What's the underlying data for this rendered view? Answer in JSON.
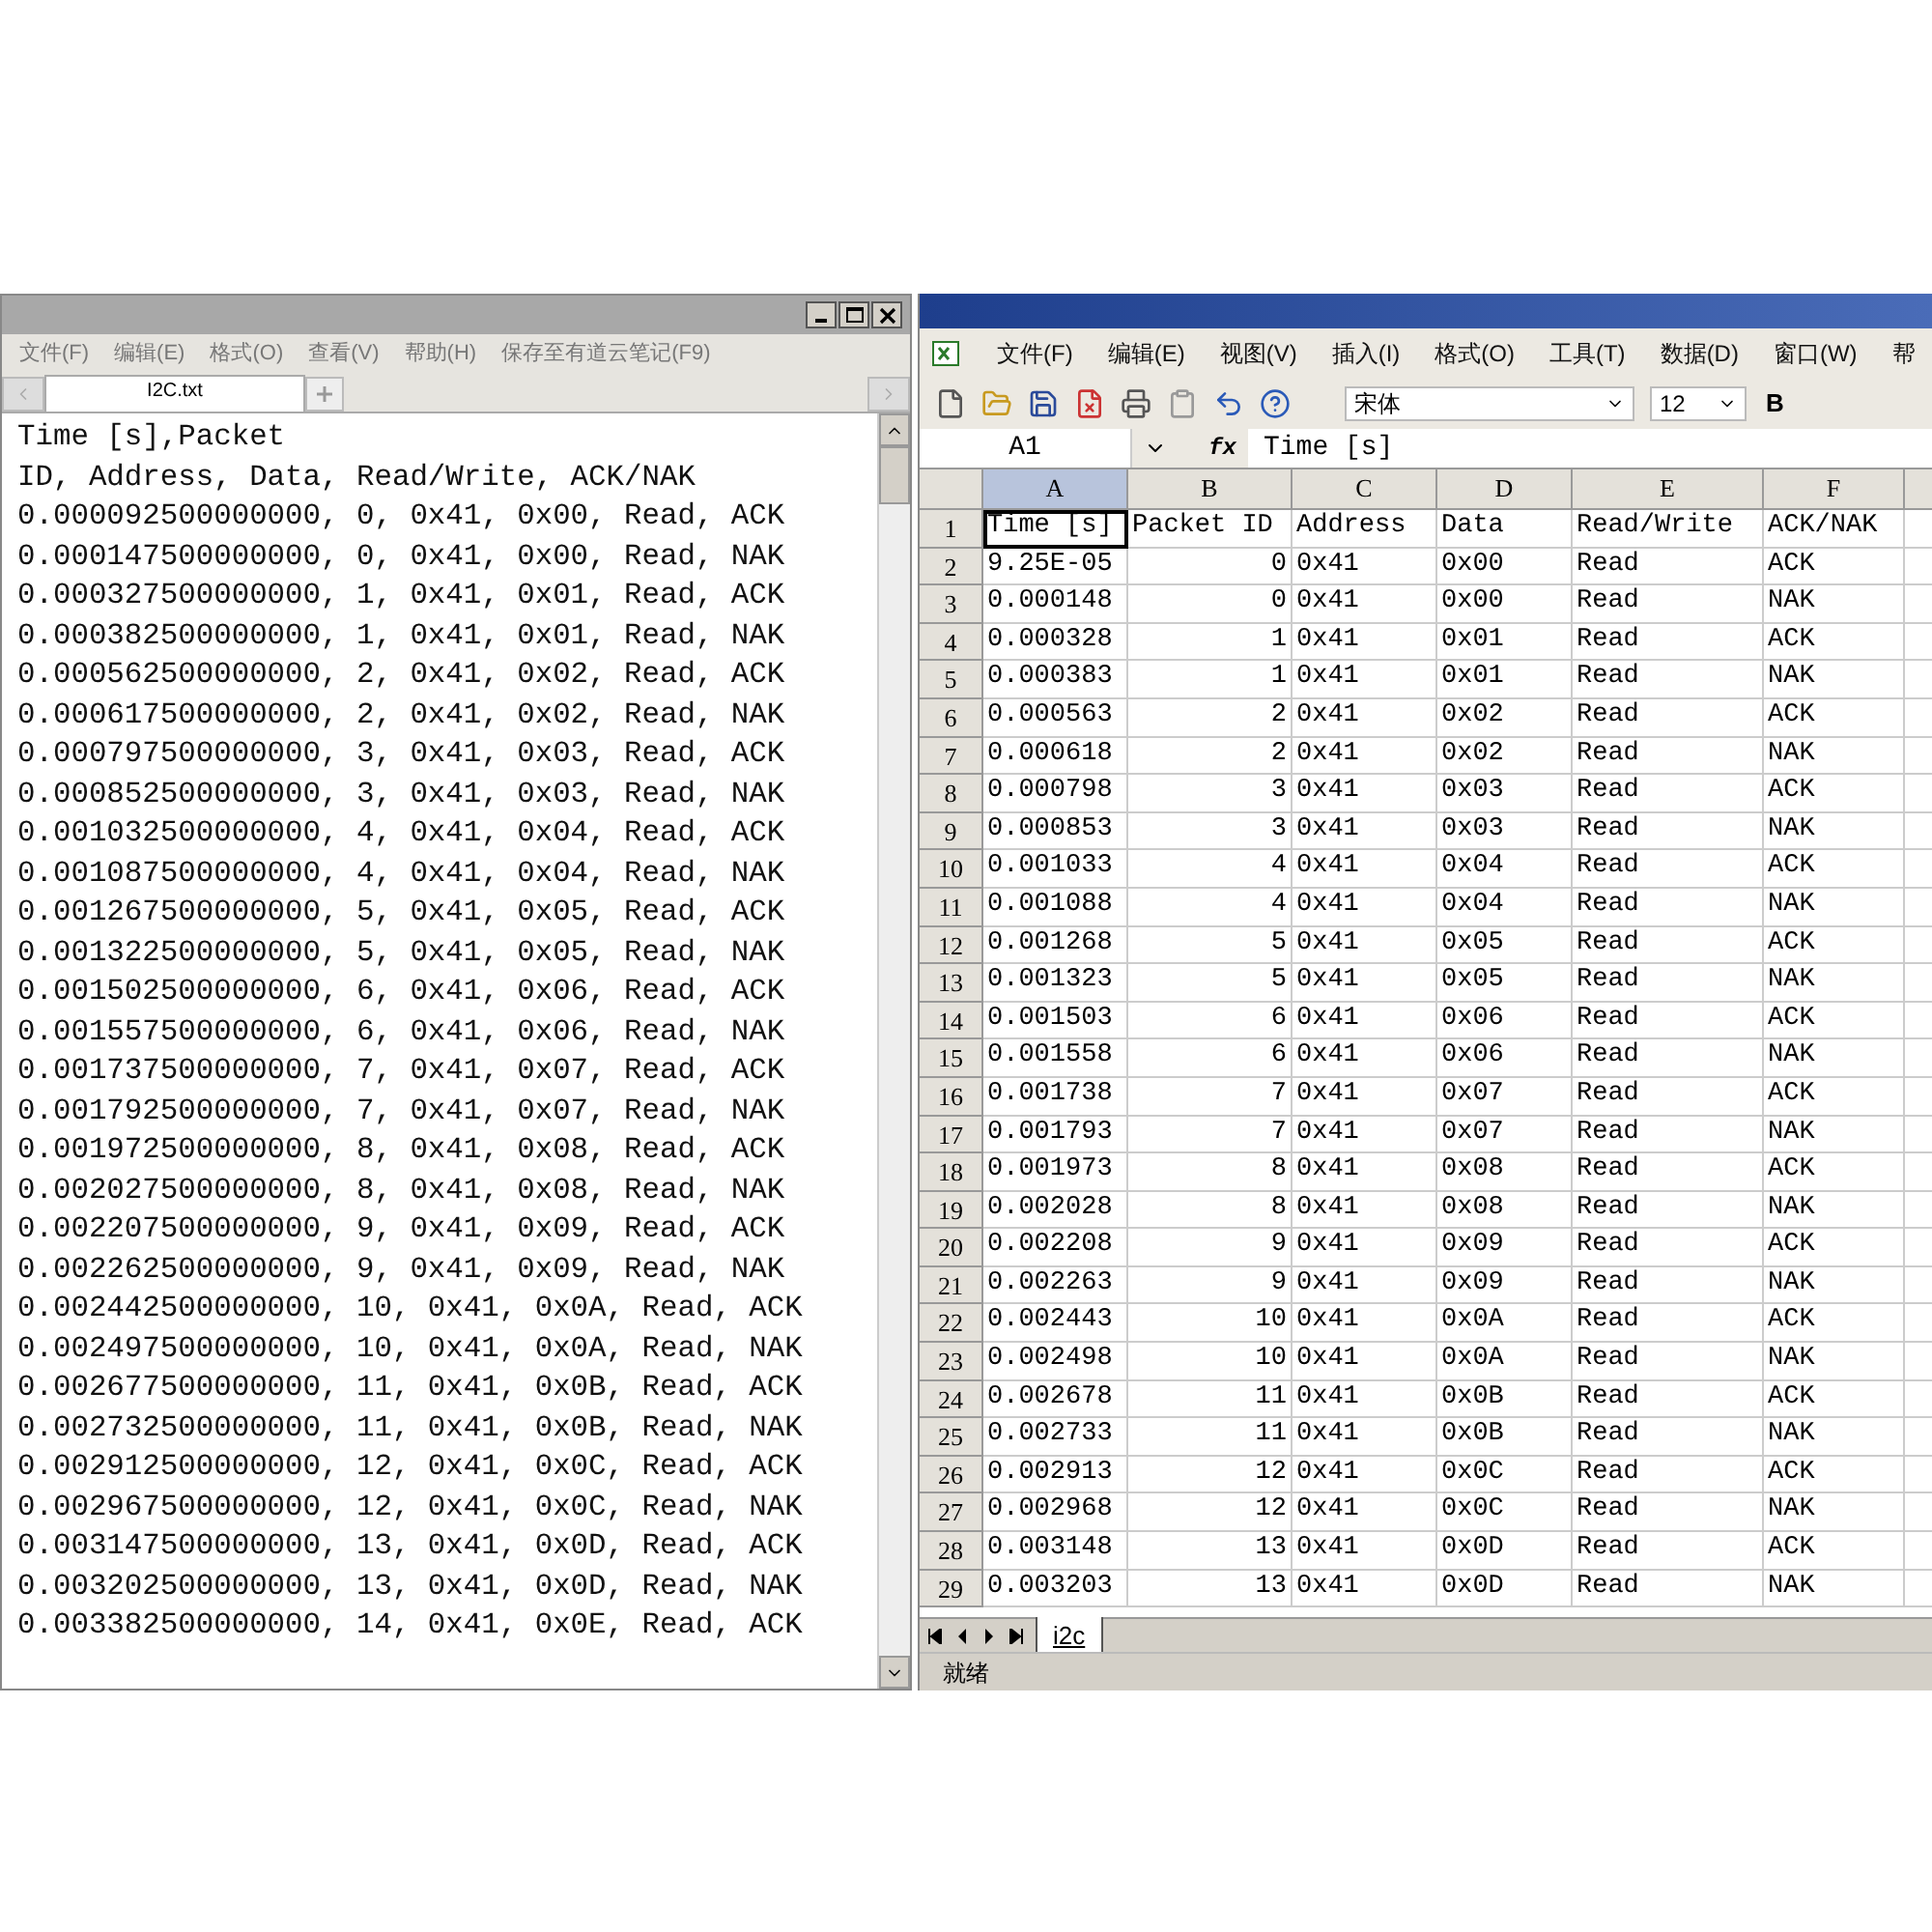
{
  "notepad": {
    "menu": [
      "文件(F)",
      "编辑(E)",
      "格式(O)",
      "查看(V)",
      "帮助(H)",
      "保存至有道云笔记(F9)"
    ],
    "tabs": [
      {
        "label": "I2C.txt",
        "selected": true
      }
    ],
    "lines": [
      "Time [s],Packet",
      "ID, Address, Data, Read/Write, ACK/NAK",
      "0.000092500000000, 0, 0x41, 0x00, Read, ACK",
      "0.000147500000000, 0, 0x41, 0x00, Read, NAK",
      "0.000327500000000, 1, 0x41, 0x01, Read, ACK",
      "0.000382500000000, 1, 0x41, 0x01, Read, NAK",
      "0.000562500000000, 2, 0x41, 0x02, Read, ACK",
      "0.000617500000000, 2, 0x41, 0x02, Read, NAK",
      "0.000797500000000, 3, 0x41, 0x03, Read, ACK",
      "0.000852500000000, 3, 0x41, 0x03, Read, NAK",
      "0.001032500000000, 4, 0x41, 0x04, Read, ACK",
      "0.001087500000000, 4, 0x41, 0x04, Read, NAK",
      "0.001267500000000, 5, 0x41, 0x05, Read, ACK",
      "0.001322500000000, 5, 0x41, 0x05, Read, NAK",
      "0.001502500000000, 6, 0x41, 0x06, Read, ACK",
      "0.001557500000000, 6, 0x41, 0x06, Read, NAK",
      "0.001737500000000, 7, 0x41, 0x07, Read, ACK",
      "0.001792500000000, 7, 0x41, 0x07, Read, NAK",
      "0.001972500000000, 8, 0x41, 0x08, Read, ACK",
      "0.002027500000000, 8, 0x41, 0x08, Read, NAK",
      "0.002207500000000, 9, 0x41, 0x09, Read, ACK",
      "0.002262500000000, 9, 0x41, 0x09, Read, NAK",
      "0.002442500000000, 10, 0x41, 0x0A, Read, ACK",
      "0.002497500000000, 10, 0x41, 0x0A, Read, NAK",
      "0.002677500000000, 11, 0x41, 0x0B, Read, ACK",
      "0.002732500000000, 11, 0x41, 0x0B, Read, NAK",
      "0.002912500000000, 12, 0x41, 0x0C, Read, ACK",
      "0.002967500000000, 12, 0x41, 0x0C, Read, NAK",
      "0.003147500000000, 13, 0x41, 0x0D, Read, ACK",
      "0.003202500000000, 13, 0x41, 0x0D, Read, NAK",
      "0.003382500000000, 14, 0x41, 0x0E, Read, ACK"
    ]
  },
  "spreadsheet": {
    "menu": [
      "文件(F)",
      "编辑(E)",
      "视图(V)",
      "插入(I)",
      "格式(O)",
      "工具(T)",
      "数据(D)",
      "窗口(W)",
      "帮"
    ],
    "font": "宋体",
    "font_size": "12",
    "bold_button": "B",
    "name_box": "A1",
    "fx": "fx",
    "formula": "Time [s]",
    "columns": [
      {
        "label": "A",
        "selected": true
      },
      {
        "label": "B",
        "selected": false
      },
      {
        "label": "C",
        "selected": false
      },
      {
        "label": "D",
        "selected": false
      },
      {
        "label": "E",
        "selected": false
      },
      {
        "label": "F",
        "selected": false
      }
    ],
    "rows": [
      {
        "number": "1",
        "cells": [
          "Time [s]",
          "Packet ID",
          "Address",
          "Data",
          "Read/Write",
          "ACK/NAK"
        ]
      },
      {
        "number": "2",
        "cells": [
          "9.25E-05",
          "0",
          "0x41",
          "0x00",
          "Read",
          "ACK"
        ]
      },
      {
        "number": "3",
        "cells": [
          "0.000148",
          "0",
          "0x41",
          "0x00",
          "Read",
          "NAK"
        ]
      },
      {
        "number": "4",
        "cells": [
          "0.000328",
          "1",
          "0x41",
          "0x01",
          "Read",
          "ACK"
        ]
      },
      {
        "number": "5",
        "cells": [
          "0.000383",
          "1",
          "0x41",
          "0x01",
          "Read",
          "NAK"
        ]
      },
      {
        "number": "6",
        "cells": [
          "0.000563",
          "2",
          "0x41",
          "0x02",
          "Read",
          "ACK"
        ]
      },
      {
        "number": "7",
        "cells": [
          "0.000618",
          "2",
          "0x41",
          "0x02",
          "Read",
          "NAK"
        ]
      },
      {
        "number": "8",
        "cells": [
          "0.000798",
          "3",
          "0x41",
          "0x03",
          "Read",
          "ACK"
        ]
      },
      {
        "number": "9",
        "cells": [
          "0.000853",
          "3",
          "0x41",
          "0x03",
          "Read",
          "NAK"
        ]
      },
      {
        "number": "10",
        "cells": [
          "0.001033",
          "4",
          "0x41",
          "0x04",
          "Read",
          "ACK"
        ]
      },
      {
        "number": "11",
        "cells": [
          "0.001088",
          "4",
          "0x41",
          "0x04",
          "Read",
          "NAK"
        ]
      },
      {
        "number": "12",
        "cells": [
          "0.001268",
          "5",
          "0x41",
          "0x05",
          "Read",
          "ACK"
        ]
      },
      {
        "number": "13",
        "cells": [
          "0.001323",
          "5",
          "0x41",
          "0x05",
          "Read",
          "NAK"
        ]
      },
      {
        "number": "14",
        "cells": [
          "0.001503",
          "6",
          "0x41",
          "0x06",
          "Read",
          "ACK"
        ]
      },
      {
        "number": "15",
        "cells": [
          "0.001558",
          "6",
          "0x41",
          "0x06",
          "Read",
          "NAK"
        ]
      },
      {
        "number": "16",
        "cells": [
          "0.001738",
          "7",
          "0x41",
          "0x07",
          "Read",
          "ACK"
        ]
      },
      {
        "number": "17",
        "cells": [
          "0.001793",
          "7",
          "0x41",
          "0x07",
          "Read",
          "NAK"
        ]
      },
      {
        "number": "18",
        "cells": [
          "0.001973",
          "8",
          "0x41",
          "0x08",
          "Read",
          "ACK"
        ]
      },
      {
        "number": "19",
        "cells": [
          "0.002028",
          "8",
          "0x41",
          "0x08",
          "Read",
          "NAK"
        ]
      },
      {
        "number": "20",
        "cells": [
          "0.002208",
          "9",
          "0x41",
          "0x09",
          "Read",
          "ACK"
        ]
      },
      {
        "number": "21",
        "cells": [
          "0.002263",
          "9",
          "0x41",
          "0x09",
          "Read",
          "NAK"
        ]
      },
      {
        "number": "22",
        "cells": [
          "0.002443",
          "10",
          "0x41",
          "0x0A",
          "Read",
          "ACK"
        ]
      },
      {
        "number": "23",
        "cells": [
          "0.002498",
          "10",
          "0x41",
          "0x0A",
          "Read",
          "NAK"
        ]
      },
      {
        "number": "24",
        "cells": [
          "0.002678",
          "11",
          "0x41",
          "0x0B",
          "Read",
          "ACK"
        ]
      },
      {
        "number": "25",
        "cells": [
          "0.002733",
          "11",
          "0x41",
          "0x0B",
          "Read",
          "NAK"
        ]
      },
      {
        "number": "26",
        "cells": [
          "0.002913",
          "12",
          "0x41",
          "0x0C",
          "Read",
          "ACK"
        ]
      },
      {
        "number": "27",
        "cells": [
          "0.002968",
          "12",
          "0x41",
          "0x0C",
          "Read",
          "NAK"
        ]
      },
      {
        "number": "28",
        "cells": [
          "0.003148",
          "13",
          "0x41",
          "0x0D",
          "Read",
          "ACK"
        ]
      },
      {
        "number": "29",
        "cells": [
          "0.003203",
          "13",
          "0x41",
          "0x0D",
          "Read",
          "NAK"
        ]
      }
    ],
    "sheet_tabs": [
      {
        "label": "i2c",
        "selected": true
      }
    ],
    "status": "就绪"
  }
}
